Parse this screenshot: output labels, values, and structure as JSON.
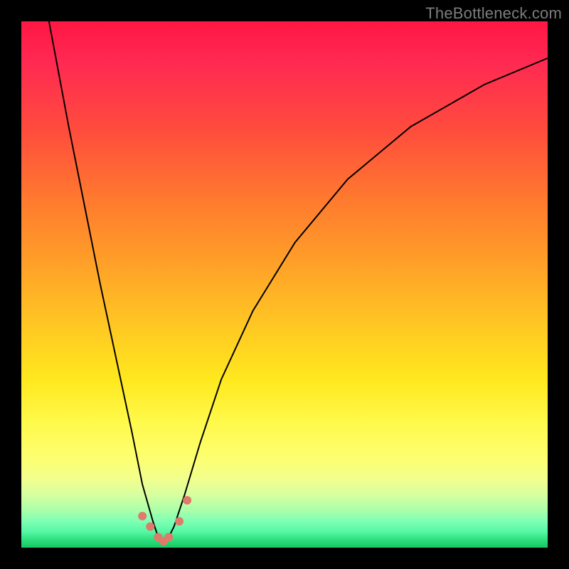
{
  "watermark_text": "TheBottleneck.com",
  "chart_data": {
    "type": "line",
    "title": "",
    "xlabel": "",
    "ylabel": "",
    "xlim": [
      0,
      100
    ],
    "ylim": [
      0,
      100
    ],
    "x_minimum": 27,
    "series": [
      {
        "name": "bottleneck-curve",
        "x": [
          0,
          3,
          6,
          9,
          12,
          15,
          18,
          21,
          23,
          25,
          26,
          27,
          28,
          29,
          31,
          34,
          38,
          44,
          52,
          62,
          74,
          88,
          100
        ],
        "y": [
          130,
          112,
          96,
          80,
          65,
          50,
          36,
          22,
          12,
          5,
          2,
          1,
          2,
          4,
          10,
          20,
          32,
          45,
          58,
          70,
          80,
          88,
          93
        ]
      }
    ],
    "dots": {
      "name": "highlight-dots",
      "points": [
        {
          "x": 23,
          "y": 6
        },
        {
          "x": 24.5,
          "y": 4
        },
        {
          "x": 26,
          "y": 2
        },
        {
          "x": 27,
          "y": 1.2
        },
        {
          "x": 28,
          "y": 2
        },
        {
          "x": 30,
          "y": 5
        },
        {
          "x": 31.5,
          "y": 9
        }
      ]
    }
  }
}
